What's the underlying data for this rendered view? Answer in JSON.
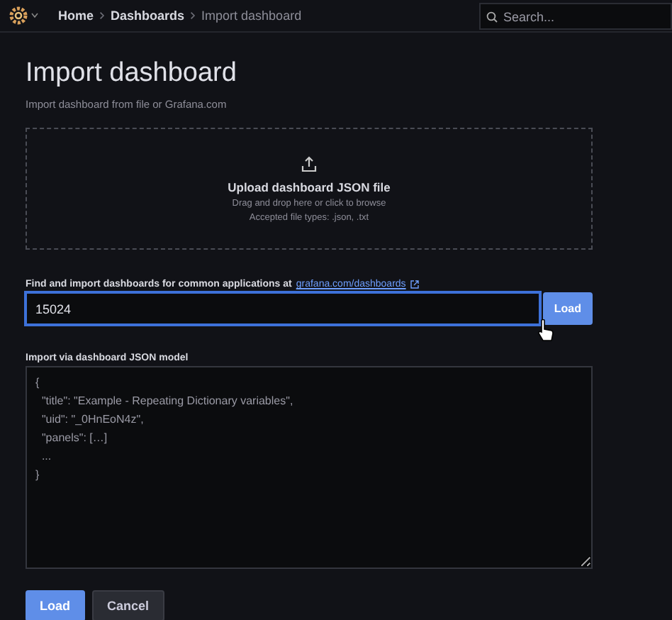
{
  "topbar": {
    "breadcrumbs": [
      {
        "label": "Home",
        "selected": false
      },
      {
        "label": "Dashboards",
        "selected": false
      },
      {
        "label": "Import dashboard",
        "selected": true
      }
    ],
    "search": {
      "placeholder": "Search..."
    }
  },
  "page": {
    "title": "Import dashboard",
    "subtitle": "Import dashboard from file or Grafana.com"
  },
  "upload": {
    "title": "Upload dashboard JSON file",
    "hint": "Drag and drop here or click to browse",
    "types": "Accepted file types: .json, .txt"
  },
  "grafana_import": {
    "label": "Find and import dashboards for common applications at",
    "link": "grafana.com/dashboards",
    "value": "15024",
    "button": "Load"
  },
  "json_import": {
    "label": "Import via dashboard JSON model",
    "placeholder_lines": [
      "{",
      "  \"title\": \"Example - Repeating Dictionary variables\",",
      "  \"uid\": \"_0HnEoN4z\",",
      "  \"panels\": […]",
      "  ...",
      "}"
    ]
  },
  "buttons": [
    {
      "label": "Load",
      "kind": "primary"
    },
    {
      "label": "Cancel",
      "kind": "secondary"
    }
  ]
}
